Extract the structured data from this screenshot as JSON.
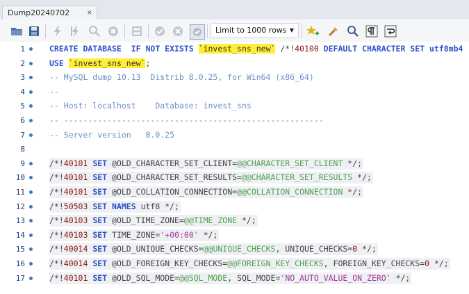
{
  "tab": {
    "title": "Dump20240702",
    "close": "×"
  },
  "toolbar": {
    "limit_select": "Limit to 1000 rows",
    "buttons": [
      "folder-icon",
      "save-icon",
      "execute-icon",
      "execute-statement-icon",
      "explain-icon",
      "stop-icon",
      "toggle-results-icon",
      "commit-icon",
      "rollback-icon",
      "autocommit-icon",
      "add-snippet-icon",
      "beautify-icon",
      "find-icon",
      "invisible-chars-icon",
      "wrap-icon"
    ]
  },
  "lines": [
    {
      "n": "1",
      "parts": [
        [
          "kw",
          "CREATE DATABASE  IF NOT EXISTS "
        ],
        [
          "hl",
          "`invest_sns_new`"
        ],
        [
          "ct",
          " /*!"
        ],
        [
          "num",
          "40100"
        ],
        [
          "kw",
          " DEFAULT CHARACTER SET utf8mb4"
        ]
      ]
    },
    {
      "n": "2",
      "parts": [
        [
          "kw",
          "USE "
        ],
        [
          "hl",
          "`invest_sns_new`"
        ],
        [
          "ct",
          ";"
        ]
      ]
    },
    {
      "n": "3",
      "parts": [
        [
          "cm",
          "-- MySQL dump 10.13  Distrib 8.0.25, for Win64 (x86_64)"
        ]
      ]
    },
    {
      "n": "4",
      "parts": [
        [
          "cm",
          "--"
        ]
      ]
    },
    {
      "n": "5",
      "parts": [
        [
          "cm",
          "-- Host: localhost    Database: invest_sns"
        ]
      ]
    },
    {
      "n": "6",
      "parts": [
        [
          "cm",
          "-- ------------------------------------------------------"
        ]
      ]
    },
    {
      "n": "7",
      "parts": [
        [
          "cm",
          "-- Server version   8.0.25"
        ]
      ]
    },
    {
      "n": "8",
      "parts": []
    },
    {
      "n": "9",
      "parts": [
        [
          "ct",
          "/*!"
        ],
        [
          "num",
          "40101"
        ],
        [
          "kw",
          " SET "
        ],
        [
          "ct",
          "@OLD_CHARACTER_SET_CLIENT="
        ],
        [
          "gv",
          "@@CHARACTER_SET_CLIENT"
        ],
        [
          "ct",
          " */;"
        ]
      ]
    },
    {
      "n": "10",
      "parts": [
        [
          "ct",
          "/*!"
        ],
        [
          "num",
          "40101"
        ],
        [
          "kw",
          " SET "
        ],
        [
          "ct",
          "@OLD_CHARACTER_SET_RESULTS="
        ],
        [
          "gv",
          "@@CHARACTER_SET_RESULTS"
        ],
        [
          "ct",
          " */;"
        ]
      ]
    },
    {
      "n": "11",
      "parts": [
        [
          "ct",
          "/*!"
        ],
        [
          "num",
          "40101"
        ],
        [
          "kw",
          " SET "
        ],
        [
          "ct",
          "@OLD_COLLATION_CONNECTION="
        ],
        [
          "gv",
          "@@COLLATION_CONNECTION"
        ],
        [
          "ct",
          " */;"
        ]
      ]
    },
    {
      "n": "12",
      "parts": [
        [
          "ct",
          "/*!"
        ],
        [
          "num",
          "50503"
        ],
        [
          "kw",
          " SET NAMES "
        ],
        [
          "ct",
          "utf8 */;"
        ]
      ]
    },
    {
      "n": "13",
      "parts": [
        [
          "ct",
          "/*!"
        ],
        [
          "num",
          "40103"
        ],
        [
          "kw",
          " SET "
        ],
        [
          "ct",
          "@OLD_TIME_ZONE="
        ],
        [
          "gv",
          "@@TIME_ZONE"
        ],
        [
          "ct",
          " */;"
        ]
      ]
    },
    {
      "n": "14",
      "parts": [
        [
          "ct",
          "/*!"
        ],
        [
          "num",
          "40103"
        ],
        [
          "kw",
          " SET "
        ],
        [
          "ct",
          "TIME_ZONE="
        ],
        [
          "str",
          "'+00:00'"
        ],
        [
          "ct",
          " */;"
        ]
      ]
    },
    {
      "n": "15",
      "parts": [
        [
          "ct",
          "/*!"
        ],
        [
          "num",
          "40014"
        ],
        [
          "kw",
          " SET "
        ],
        [
          "ct",
          "@OLD_UNIQUE_CHECKS="
        ],
        [
          "gv",
          "@@UNIQUE_CHECKS"
        ],
        [
          "ct",
          ", UNIQUE_CHECKS="
        ],
        [
          "num",
          "0"
        ],
        [
          "ct",
          " */;"
        ]
      ]
    },
    {
      "n": "16",
      "parts": [
        [
          "ct",
          "/*!"
        ],
        [
          "num",
          "40014"
        ],
        [
          "kw",
          " SET "
        ],
        [
          "ct",
          "@OLD_FOREIGN_KEY_CHECKS="
        ],
        [
          "gv",
          "@@FOREIGN_KEY_CHECKS"
        ],
        [
          "ct",
          ", FOREIGN_KEY_CHECKS="
        ],
        [
          "num",
          "0"
        ],
        [
          "ct",
          " */;"
        ]
      ]
    },
    {
      "n": "17",
      "parts": [
        [
          "ct",
          "/*!"
        ],
        [
          "num",
          "40101"
        ],
        [
          "kw",
          " SET "
        ],
        [
          "ct",
          "@OLD_SQL_MODE="
        ],
        [
          "gv",
          "@@SQL_MODE"
        ],
        [
          "ct",
          ", SQL_MODE="
        ],
        [
          "str",
          "'NO_AUTO_VALUE_ON_ZERO'"
        ],
        [
          "ct",
          " */;"
        ]
      ]
    }
  ]
}
